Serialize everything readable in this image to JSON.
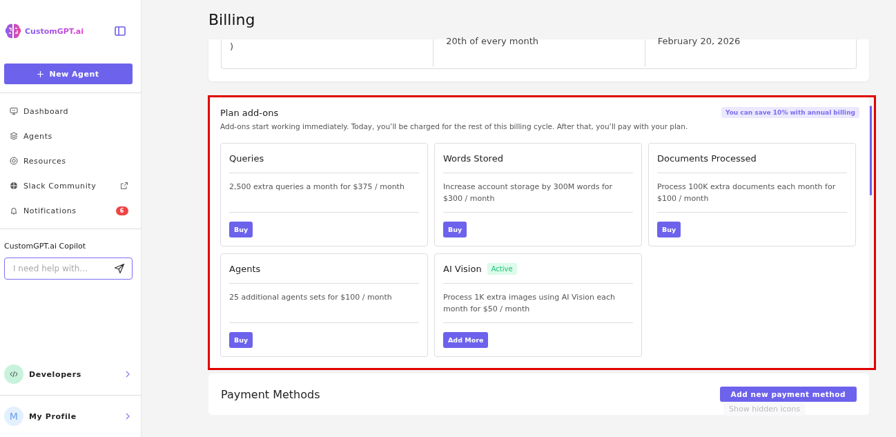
{
  "sidebar": {
    "brand": "CustomGPT.ai",
    "new_button": "New Agent",
    "nav": [
      {
        "kind": "dashboard",
        "label": "Dashboard",
        "external": false
      },
      {
        "kind": "agents",
        "label": "Agents",
        "external": false
      },
      {
        "kind": "resources",
        "label": "Resources",
        "external": false
      },
      {
        "kind": "slack",
        "label": "Slack Community",
        "external": true
      },
      {
        "kind": "notifications",
        "label": "Notifications",
        "external": false,
        "badge": "6"
      }
    ],
    "copilot": {
      "title": "CustomGPT.ai Copilot",
      "placeholder": "I need help with..."
    },
    "developers": {
      "label": "Developers"
    },
    "profile": {
      "initial": "M",
      "label": "My Profile"
    }
  },
  "page_title": "Billing",
  "summary_cells": [
    ")",
    "20th of every month",
    "February 20, 2026"
  ],
  "addons": {
    "title": "Plan add-ons",
    "highlighted": true,
    "promo": "You can save 10% with annual billing",
    "description": "Add-ons start working immediately. Today, you’ll be charged for the rest of this billing cycle. After that, you’ll pay with your plan.",
    "cards": [
      {
        "title": "Queries",
        "active": false,
        "description": "2,500 extra queries a month for $375 / month",
        "button": "Buy"
      },
      {
        "title": "Words Stored",
        "active": false,
        "description": "Increase account storage by 300M words for $300 / month",
        "button": "Buy"
      },
      {
        "title": "Documents Processed",
        "active": false,
        "description": "Process 100K extra documents each month for $100 / month",
        "button": "Buy"
      },
      {
        "title": "Agents",
        "active": false,
        "description": "25 additional agents sets for $100 / month",
        "button": "Buy"
      },
      {
        "title": "AI Vision",
        "active": true,
        "active_label": "Active",
        "description": "Process 1K extra images using AI Vision each month for $50 / month",
        "button": "Add More"
      }
    ]
  },
  "payment": {
    "title": "Payment Methods",
    "button": "Add new payment method"
  },
  "tooltip": "Show hidden icons"
}
